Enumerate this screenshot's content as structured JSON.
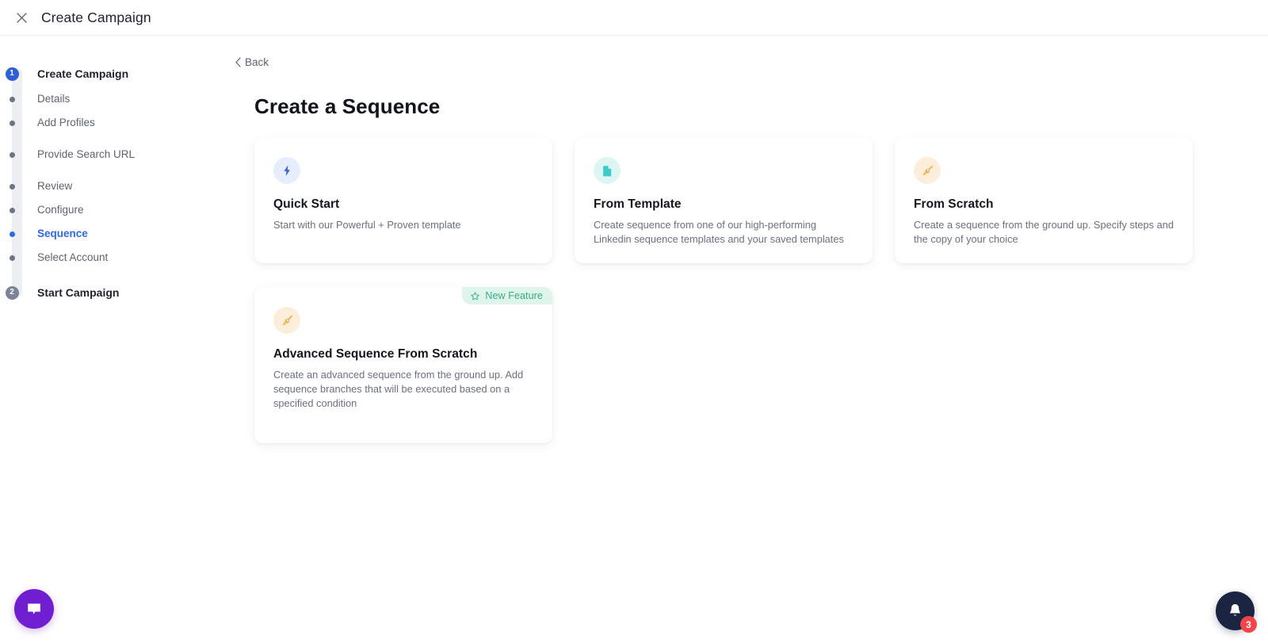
{
  "header": {
    "title": "Create Campaign",
    "close_icon": "close-icon"
  },
  "sidebar": {
    "steps": [
      {
        "label": "Create Campaign",
        "marker": "1",
        "type": "number",
        "state": "current-section"
      },
      {
        "label": "Details",
        "marker": "dot",
        "type": "dot",
        "state": "default"
      },
      {
        "label": "Add Profiles",
        "marker": "dot",
        "type": "dot",
        "state": "default"
      },
      {
        "label": "Provide Search URL",
        "marker": "dot",
        "type": "dot",
        "state": "default"
      },
      {
        "label": "Review",
        "marker": "dot",
        "type": "dot",
        "state": "default"
      },
      {
        "label": "Configure",
        "marker": "dot",
        "type": "dot",
        "state": "default"
      },
      {
        "label": "Sequence",
        "marker": "dot",
        "type": "dot",
        "state": "active"
      },
      {
        "label": "Select Account",
        "marker": "dot",
        "type": "dot",
        "state": "default"
      },
      {
        "label": "Start Campaign",
        "marker": "2",
        "type": "number",
        "state": "upcoming"
      }
    ]
  },
  "main": {
    "back_label": "Back",
    "back_icon": "chevron-left-icon",
    "page_title": "Create a Sequence",
    "cards": [
      {
        "title": "Quick Start",
        "description": "Start with our Powerful + Proven template",
        "icon": "lightning-bolt-icon",
        "icon_theme": "blue"
      },
      {
        "title": "From Template",
        "description": "Create sequence from one of our high-performing Linkedin sequence templates and your saved templates",
        "icon": "document-icon",
        "icon_theme": "teal"
      },
      {
        "title": "From Scratch",
        "description": "Create a sequence from the ground up. Specify steps and the copy of your choice",
        "icon": "pen-nib-icon",
        "icon_theme": "orange"
      },
      {
        "title": "Advanced Sequence From Scratch",
        "description": "Create an advanced sequence from the ground up. Add sequence branches that will be executed based on a specified condition",
        "icon": "pen-nib-icon",
        "icon_theme": "orange",
        "badge": "New Feature",
        "badge_icon": "star-outline-icon"
      }
    ]
  },
  "widgets": {
    "chat": {
      "icon": "chat-bubble-icon"
    },
    "notifications": {
      "icon": "bell-icon",
      "count": "3"
    }
  },
  "colors": {
    "accent_blue": "#2e6ae6",
    "badge_green_bg": "#dff5ec",
    "badge_green_text": "#3aa98a",
    "chat_purple": "#6f1fd0",
    "notif_navy": "#1b2542",
    "notif_red": "#f34449"
  }
}
